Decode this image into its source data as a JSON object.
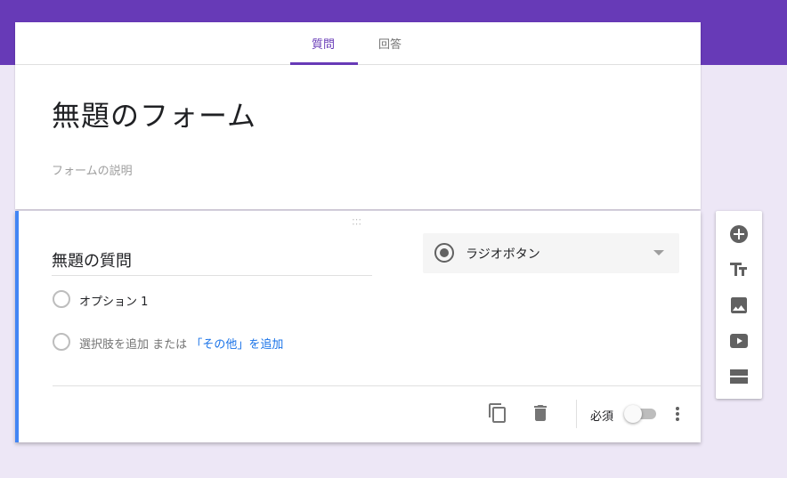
{
  "tabs": [
    {
      "label": "質問",
      "active": true
    },
    {
      "label": "回答",
      "active": false
    }
  ],
  "form": {
    "title": "無題のフォーム",
    "description_placeholder": "フォームの説明"
  },
  "question": {
    "title": "無題の質問",
    "type_label": "ラジオボタン",
    "options": [
      {
        "label": "オプション 1"
      }
    ],
    "add_option_label": "選択肢を追加",
    "or_label": "または",
    "add_other_label": "「その他」を追加",
    "required_label": "必須",
    "required": false
  },
  "icons": {
    "copy": "copy-icon",
    "delete": "trash-icon",
    "more": "more-vert-icon",
    "add_question": "add-circle-icon",
    "add_title": "title-text-icon",
    "add_image": "image-icon",
    "add_video": "video-icon",
    "add_section": "section-icon"
  },
  "colors": {
    "theme": "#673ab7",
    "background": "#ede7f6",
    "accent": "#4285f4",
    "link": "#1a73e8"
  }
}
